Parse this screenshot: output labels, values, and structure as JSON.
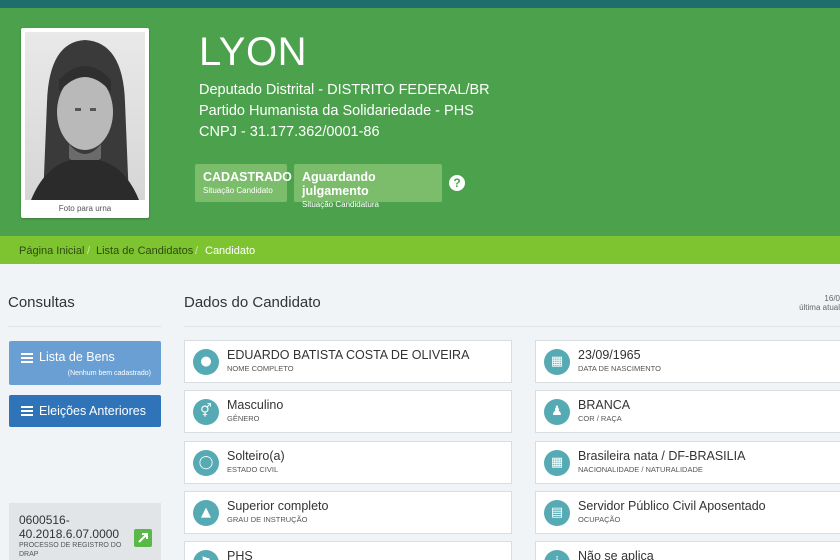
{
  "header": {
    "name": "LYON",
    "cargo": "Deputado Distrital - DISTRITO FEDERAL/BR",
    "partido": "Partido Humanista da Solidariedade - PHS",
    "cnpj": "CNPJ - 31.177.362/0001-86",
    "photo_caption": "Foto para urna",
    "badges": [
      {
        "title": "CADASTRADO",
        "subtitle": "Situação Candidato"
      },
      {
        "title": "Aguardando julgamento",
        "subtitle": "Situação Candidatura"
      }
    ],
    "help_glyph": "?"
  },
  "breadcrumb": [
    "Página Inicial",
    "Lista de Candidatos",
    "Candidato"
  ],
  "sidebar": {
    "title": "Consultas",
    "buttons": [
      {
        "label": "Lista de Bens",
        "note": "(Nenhum bem cadastrado)",
        "icon": "list-icon"
      },
      {
        "label": "Eleições Anteriores",
        "icon": "list-icon"
      }
    ],
    "drap": {
      "number": "0600516-40.2018.6.07.0000",
      "caption": "PROCESSO DE REGISTRO DO DRAP",
      "icon": "external-link-icon"
    }
  },
  "content": {
    "title": "Dados do Candidato",
    "date_value": "16/0",
    "date_label": "última atual",
    "fields": [
      {
        "value": "EDUARDO BATISTA COSTA DE OLIVEIRA",
        "label": "NOME COMPLETO",
        "icon": "user-icon"
      },
      {
        "value": "23/09/1965",
        "label": "DATA DE NASCIMENTO",
        "icon": "calendar-icon"
      },
      {
        "value": "Masculino",
        "label": "GÊNERO",
        "icon": "gender-icon"
      },
      {
        "value": "BRANCA",
        "label": "COR / RAÇA",
        "icon": "person-icon"
      },
      {
        "value": "Solteiro(a)",
        "label": "ESTADO CIVIL",
        "icon": "ring-icon"
      },
      {
        "value": "Brasileira nata / DF-BRASILIA",
        "label": "NACIONALIDADE / NATURALIDADE",
        "icon": "map-icon"
      },
      {
        "value": "Superior completo",
        "label": "GRAU DE INSTRUÇÃO",
        "icon": "graduation-icon"
      },
      {
        "value": "Servidor Público Civil Aposentado",
        "label": "OCUPAÇÃO",
        "icon": "bank-icon"
      },
      {
        "value": "PHS",
        "label": "",
        "icon": "flag-icon"
      },
      {
        "value": "Não se aplica",
        "label": "",
        "icon": "info-icon"
      }
    ]
  },
  "colors": {
    "header": "#4ca24c",
    "breadcrumb": "#7ec430",
    "button_blue_light": "#6a9fd4",
    "button_blue": "#2f74b9",
    "icon_teal": "#55aab3"
  }
}
